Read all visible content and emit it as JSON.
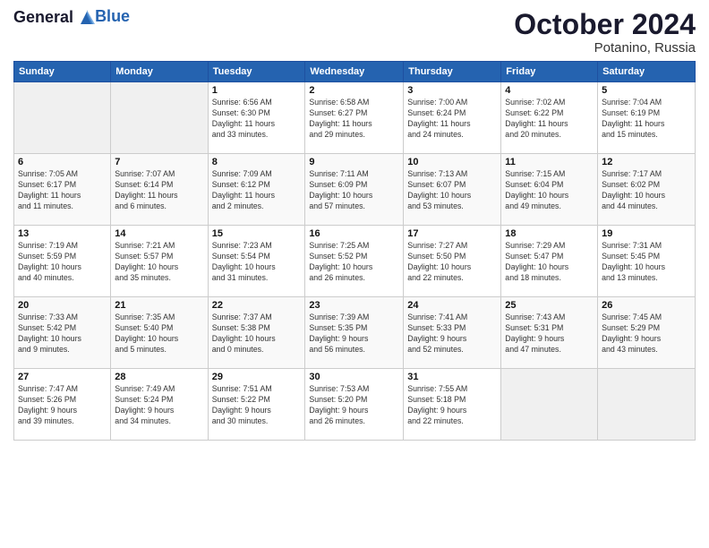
{
  "header": {
    "logo_line1": "General",
    "logo_line2": "Blue",
    "month": "October 2024",
    "location": "Potanino, Russia"
  },
  "weekdays": [
    "Sunday",
    "Monday",
    "Tuesday",
    "Wednesday",
    "Thursday",
    "Friday",
    "Saturday"
  ],
  "weeks": [
    [
      {
        "day": "",
        "info": ""
      },
      {
        "day": "",
        "info": ""
      },
      {
        "day": "1",
        "info": "Sunrise: 6:56 AM\nSunset: 6:30 PM\nDaylight: 11 hours\nand 33 minutes."
      },
      {
        "day": "2",
        "info": "Sunrise: 6:58 AM\nSunset: 6:27 PM\nDaylight: 11 hours\nand 29 minutes."
      },
      {
        "day": "3",
        "info": "Sunrise: 7:00 AM\nSunset: 6:24 PM\nDaylight: 11 hours\nand 24 minutes."
      },
      {
        "day": "4",
        "info": "Sunrise: 7:02 AM\nSunset: 6:22 PM\nDaylight: 11 hours\nand 20 minutes."
      },
      {
        "day": "5",
        "info": "Sunrise: 7:04 AM\nSunset: 6:19 PM\nDaylight: 11 hours\nand 15 minutes."
      }
    ],
    [
      {
        "day": "6",
        "info": "Sunrise: 7:05 AM\nSunset: 6:17 PM\nDaylight: 11 hours\nand 11 minutes."
      },
      {
        "day": "7",
        "info": "Sunrise: 7:07 AM\nSunset: 6:14 PM\nDaylight: 11 hours\nand 6 minutes."
      },
      {
        "day": "8",
        "info": "Sunrise: 7:09 AM\nSunset: 6:12 PM\nDaylight: 11 hours\nand 2 minutes."
      },
      {
        "day": "9",
        "info": "Sunrise: 7:11 AM\nSunset: 6:09 PM\nDaylight: 10 hours\nand 57 minutes."
      },
      {
        "day": "10",
        "info": "Sunrise: 7:13 AM\nSunset: 6:07 PM\nDaylight: 10 hours\nand 53 minutes."
      },
      {
        "day": "11",
        "info": "Sunrise: 7:15 AM\nSunset: 6:04 PM\nDaylight: 10 hours\nand 49 minutes."
      },
      {
        "day": "12",
        "info": "Sunrise: 7:17 AM\nSunset: 6:02 PM\nDaylight: 10 hours\nand 44 minutes."
      }
    ],
    [
      {
        "day": "13",
        "info": "Sunrise: 7:19 AM\nSunset: 5:59 PM\nDaylight: 10 hours\nand 40 minutes."
      },
      {
        "day": "14",
        "info": "Sunrise: 7:21 AM\nSunset: 5:57 PM\nDaylight: 10 hours\nand 35 minutes."
      },
      {
        "day": "15",
        "info": "Sunrise: 7:23 AM\nSunset: 5:54 PM\nDaylight: 10 hours\nand 31 minutes."
      },
      {
        "day": "16",
        "info": "Sunrise: 7:25 AM\nSunset: 5:52 PM\nDaylight: 10 hours\nand 26 minutes."
      },
      {
        "day": "17",
        "info": "Sunrise: 7:27 AM\nSunset: 5:50 PM\nDaylight: 10 hours\nand 22 minutes."
      },
      {
        "day": "18",
        "info": "Sunrise: 7:29 AM\nSunset: 5:47 PM\nDaylight: 10 hours\nand 18 minutes."
      },
      {
        "day": "19",
        "info": "Sunrise: 7:31 AM\nSunset: 5:45 PM\nDaylight: 10 hours\nand 13 minutes."
      }
    ],
    [
      {
        "day": "20",
        "info": "Sunrise: 7:33 AM\nSunset: 5:42 PM\nDaylight: 10 hours\nand 9 minutes."
      },
      {
        "day": "21",
        "info": "Sunrise: 7:35 AM\nSunset: 5:40 PM\nDaylight: 10 hours\nand 5 minutes."
      },
      {
        "day": "22",
        "info": "Sunrise: 7:37 AM\nSunset: 5:38 PM\nDaylight: 10 hours\nand 0 minutes."
      },
      {
        "day": "23",
        "info": "Sunrise: 7:39 AM\nSunset: 5:35 PM\nDaylight: 9 hours\nand 56 minutes."
      },
      {
        "day": "24",
        "info": "Sunrise: 7:41 AM\nSunset: 5:33 PM\nDaylight: 9 hours\nand 52 minutes."
      },
      {
        "day": "25",
        "info": "Sunrise: 7:43 AM\nSunset: 5:31 PM\nDaylight: 9 hours\nand 47 minutes."
      },
      {
        "day": "26",
        "info": "Sunrise: 7:45 AM\nSunset: 5:29 PM\nDaylight: 9 hours\nand 43 minutes."
      }
    ],
    [
      {
        "day": "27",
        "info": "Sunrise: 7:47 AM\nSunset: 5:26 PM\nDaylight: 9 hours\nand 39 minutes."
      },
      {
        "day": "28",
        "info": "Sunrise: 7:49 AM\nSunset: 5:24 PM\nDaylight: 9 hours\nand 34 minutes."
      },
      {
        "day": "29",
        "info": "Sunrise: 7:51 AM\nSunset: 5:22 PM\nDaylight: 9 hours\nand 30 minutes."
      },
      {
        "day": "30",
        "info": "Sunrise: 7:53 AM\nSunset: 5:20 PM\nDaylight: 9 hours\nand 26 minutes."
      },
      {
        "day": "31",
        "info": "Sunrise: 7:55 AM\nSunset: 5:18 PM\nDaylight: 9 hours\nand 22 minutes."
      },
      {
        "day": "",
        "info": ""
      },
      {
        "day": "",
        "info": ""
      }
    ]
  ]
}
